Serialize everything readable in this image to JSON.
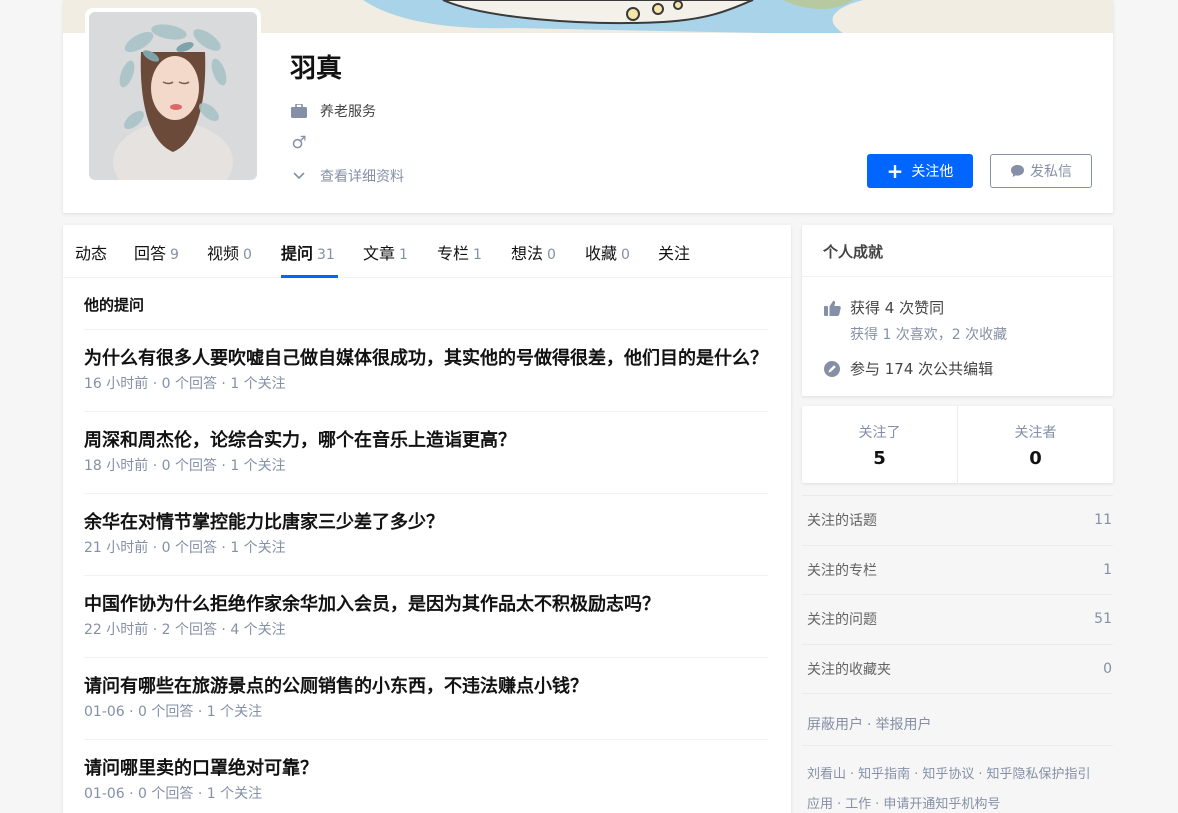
{
  "profile": {
    "name": "羽真",
    "occupation": "养老服务",
    "gender_symbol": "♂",
    "view_details": "查看详细资料",
    "follow_button": "关注他",
    "message_button": "发私信"
  },
  "tabs": [
    {
      "label": "动态",
      "count": ""
    },
    {
      "label": "回答",
      "count": "9"
    },
    {
      "label": "视频",
      "count": "0"
    },
    {
      "label": "提问",
      "count": "31"
    },
    {
      "label": "文章",
      "count": "1"
    },
    {
      "label": "专栏",
      "count": "1"
    },
    {
      "label": "想法",
      "count": "0"
    },
    {
      "label": "收藏",
      "count": "0"
    },
    {
      "label": "关注",
      "count": ""
    }
  ],
  "feed": {
    "section_title": "他的提问",
    "questions": [
      {
        "title": "为什么有很多人要吹嘘自己做自媒体很成功，其实他的号做得很差，他们目的是什么？",
        "meta": "16 小时前 · 0 个回答 · 1 个关注"
      },
      {
        "title": "周深和周杰伦，论综合实力，哪个在音乐上造诣更高？",
        "meta": "18 小时前 · 0 个回答 · 1 个关注"
      },
      {
        "title": "余华在对情节掌控能力比唐家三少差了多少？",
        "meta": "21 小时前 · 0 个回答 · 1 个关注"
      },
      {
        "title": "中国作协为什么拒绝作家余华加入会员，是因为其作品太不积极励志吗？",
        "meta": "22 小时前 · 2 个回答 · 4 个关注"
      },
      {
        "title": "请问有哪些在旅游景点的公厕销售的小东西，不违法赚点小钱？",
        "meta": "01-06 · 0 个回答 · 1 个关注"
      },
      {
        "title": "请问哪里卖的口罩绝对可靠？",
        "meta": "01-06 · 0 个回答 · 1 个关注"
      }
    ]
  },
  "achievements": {
    "title": "个人成就",
    "upvotes": "获得 4 次赞同",
    "likes_collections": "获得 1 次喜欢，2 次收藏",
    "edits": "参与 174 次公共编辑"
  },
  "follow_stats": {
    "following_label": "关注了",
    "following_count": "5",
    "followers_label": "关注者",
    "followers_count": "0"
  },
  "sidebar_list": [
    {
      "label": "关注的话题",
      "count": "11"
    },
    {
      "label": "关注的专栏",
      "count": "1"
    },
    {
      "label": "关注的问题",
      "count": "51"
    },
    {
      "label": "关注的收藏夹",
      "count": "0"
    }
  ],
  "report": {
    "block_user": "屏蔽用户",
    "report_user": "举报用户"
  },
  "footer": {
    "line1": [
      "刘看山",
      "知乎指南",
      "知乎协议",
      "知乎隐私保护指引"
    ],
    "line2": [
      "应用",
      "工作",
      "申请开通知乎机构号"
    ]
  },
  "colors": {
    "accent": "#0066ff",
    "muted": "#8590a6"
  }
}
